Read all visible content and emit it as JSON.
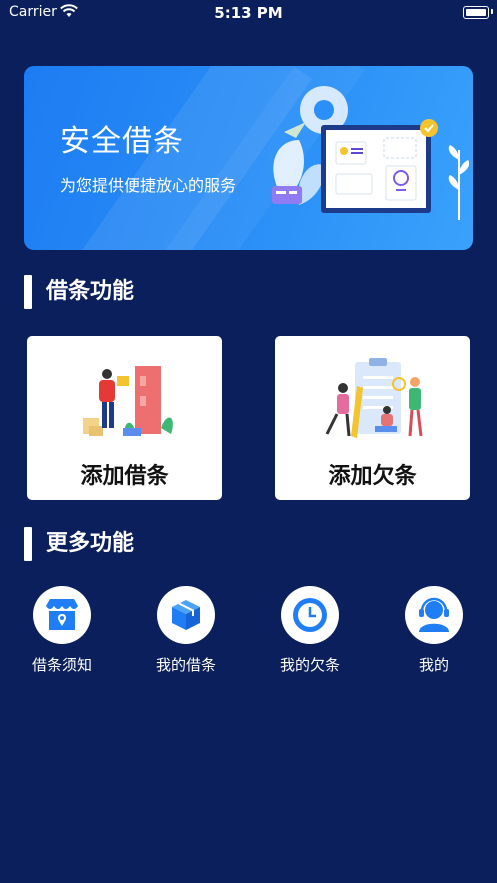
{
  "status_bar": {
    "carrier": "Carrier",
    "time": "5:13 PM"
  },
  "banner": {
    "title": "安全借条",
    "subtitle": "为您提供便捷放心的服务"
  },
  "sections": {
    "features_title": "借条功能",
    "more_title": "更多功能"
  },
  "cards": [
    {
      "label": "添加借条",
      "icon": "delivery-person-illustration"
    },
    {
      "label": "添加欠条",
      "icon": "clipboard-team-illustration"
    }
  ],
  "more": [
    {
      "label": "借条须知",
      "icon": "storefront-icon"
    },
    {
      "label": "我的借条",
      "icon": "box-icon"
    },
    {
      "label": "我的欠条",
      "icon": "clock-icon"
    },
    {
      "label": "我的",
      "icon": "headset-user-icon"
    }
  ],
  "colors": {
    "background": "#0a1f5c",
    "accent": "#2a8ff7",
    "icon_blue": "#1f7ef5"
  }
}
